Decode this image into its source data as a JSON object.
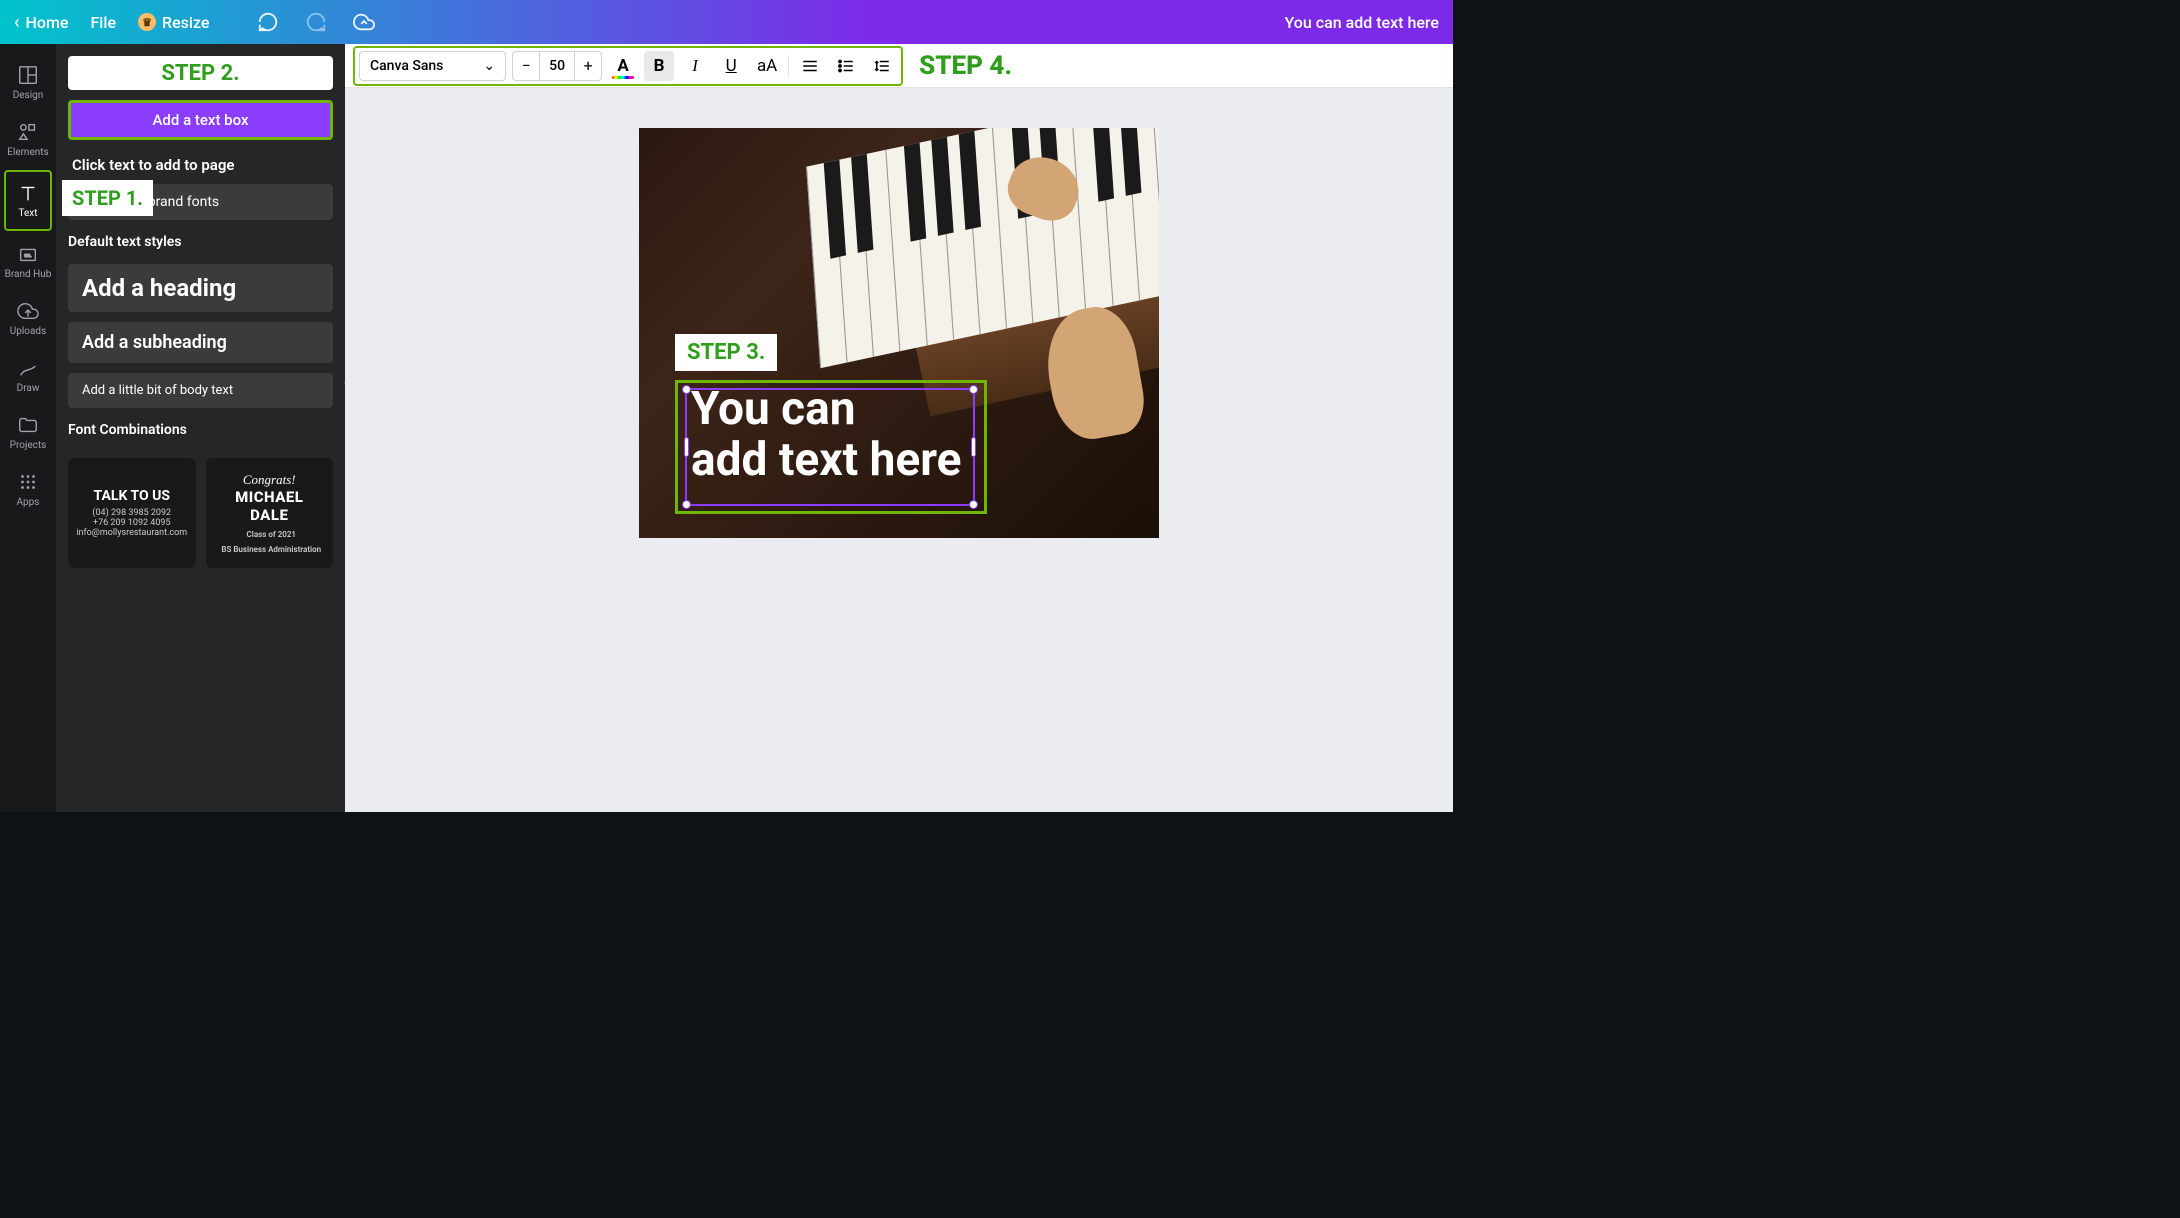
{
  "topbar": {
    "home": "Home",
    "file": "File",
    "resize": "Resize",
    "right_text": "You can add text here"
  },
  "rail": {
    "design": "Design",
    "elements": "Elements",
    "text": "Text",
    "brand_hub": "Brand Hub",
    "uploads": "Uploads",
    "draw": "Draw",
    "projects": "Projects",
    "apps": "Apps"
  },
  "panel": {
    "step2_label": "STEP 2.",
    "add_text_box": "Add a text box",
    "click_to_add": "Click text to add to page",
    "step1_label": "STEP 1.",
    "brand_fonts_suffix": "dd your brand fonts",
    "default_styles": "Default text styles",
    "heading": "Add a heading",
    "subheading": "Add a subheading",
    "body": "Add a little bit of body text",
    "font_combinations": "Font Combinations",
    "combo1": {
      "title": "TALK TO US",
      "line1": "(04) 298 3985 2092",
      "line2": "+76 209 1092 4095",
      "line3": "info@mollysrestaurant.com"
    },
    "combo2": {
      "congrats": "Congrats!",
      "name1": "MICHAEL",
      "name2": "DALE",
      "sub1": "Class of 2021",
      "sub2": "BS Business Administration"
    }
  },
  "toolbar": {
    "font_name": "Canva Sans",
    "font_size": "50",
    "step4_label": "STEP 4."
  },
  "canvas": {
    "step3_label": "STEP 3.",
    "text_line1": "You can",
    "text_line2": "add text here"
  }
}
